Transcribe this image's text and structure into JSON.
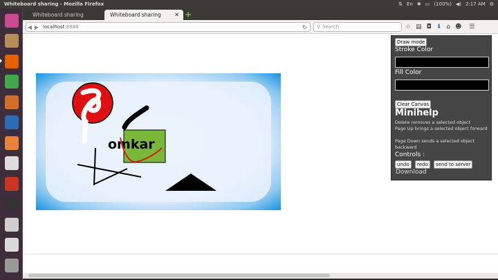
{
  "top_panel": {
    "title": "Whiteboard sharing - Mozilla Firefox",
    "battery": "(100%)",
    "clock": "2:17 AM"
  },
  "launcher": {
    "items": [
      {
        "name": "ubuntu-dash-icon",
        "color": "#c94b8f"
      },
      {
        "name": "files-icon",
        "color": "#b98d5a"
      },
      {
        "name": "firefox-icon",
        "color": "#e66000"
      },
      {
        "name": "libreoffice-calc-icon",
        "color": "#3fa84a"
      },
      {
        "name": "libreoffice-impress-icon",
        "color": "#d36d2a"
      },
      {
        "name": "libreoffice-writer-icon",
        "color": "#2a6db5"
      },
      {
        "name": "software-center-icon",
        "color": "#e8833a"
      },
      {
        "name": "amazon-icon",
        "color": "#dcdcdc"
      },
      {
        "name": "system-settings-icon",
        "color": "#cc3322"
      },
      {
        "name": "terminal-icon",
        "color": "#333333"
      },
      {
        "name": "drive-icon",
        "color": "#cfcfcf"
      },
      {
        "name": "drive-2-icon",
        "color": "#d9d9d9"
      },
      {
        "name": "trash-icon",
        "color": "#9a9a9a"
      }
    ]
  },
  "tabs": [
    {
      "label": "Whiteboard sharing",
      "active": false
    },
    {
      "label": "Whiteboard sharing",
      "active": true
    }
  ],
  "navbar": {
    "url_host": "localhost",
    "url_port": ":8888",
    "search_placeholder": "Search"
  },
  "panel": {
    "draw_mode_label": "Draw mode",
    "stroke_color_label": "Stroke Color",
    "fill_color_label": "Fill Color",
    "clear_canvas_label": "Clear Canvas",
    "minihelp_title": "Minihelp",
    "help_lines": [
      "Delete removes a selected object",
      "Page Up brings a selected object forward",
      "Page Down sends a selected object backward"
    ],
    "controls_label": "Controls :",
    "undo_label": "undo",
    "redo_label": "redo",
    "send_label": "send to server",
    "download_label": "Download",
    "stroke_color": "#000000",
    "fill_color": "#000000"
  },
  "canvas": {
    "text": "omkar",
    "border_color": "#2a9be0",
    "red_circle_color": "#e01010",
    "green_rect_color": "#7ab83a"
  }
}
